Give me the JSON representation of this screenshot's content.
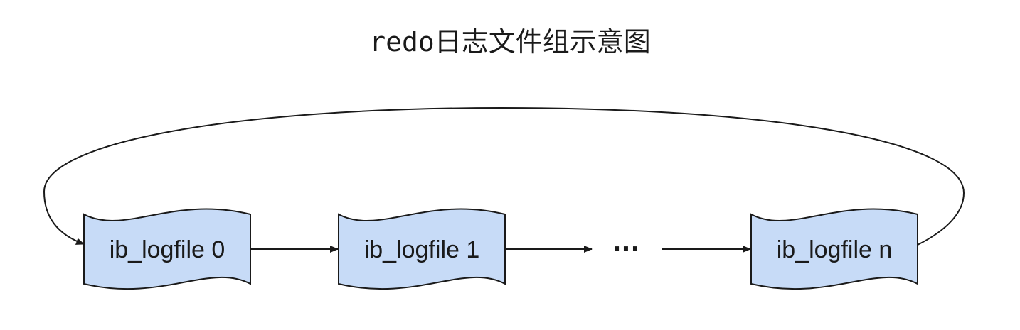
{
  "title": "redo日志文件组示意图",
  "nodes": [
    {
      "id": "file-0",
      "label": "ib_logfile 0"
    },
    {
      "id": "file-1",
      "label": "ib_logfile 1"
    },
    {
      "id": "file-n",
      "label": "ib_logfile n"
    }
  ],
  "ellipsis": "···",
  "edges": [
    {
      "from": "file-0",
      "to": "file-1"
    },
    {
      "from": "file-1",
      "to": "ellipsis"
    },
    {
      "from": "ellipsis",
      "to": "file-n"
    },
    {
      "from": "file-n",
      "to": "file-0",
      "style": "loop-back"
    }
  ],
  "colors": {
    "node_fill": "#c7dbf7",
    "stroke": "#1a1a1a",
    "text": "#1a1a1a"
  }
}
